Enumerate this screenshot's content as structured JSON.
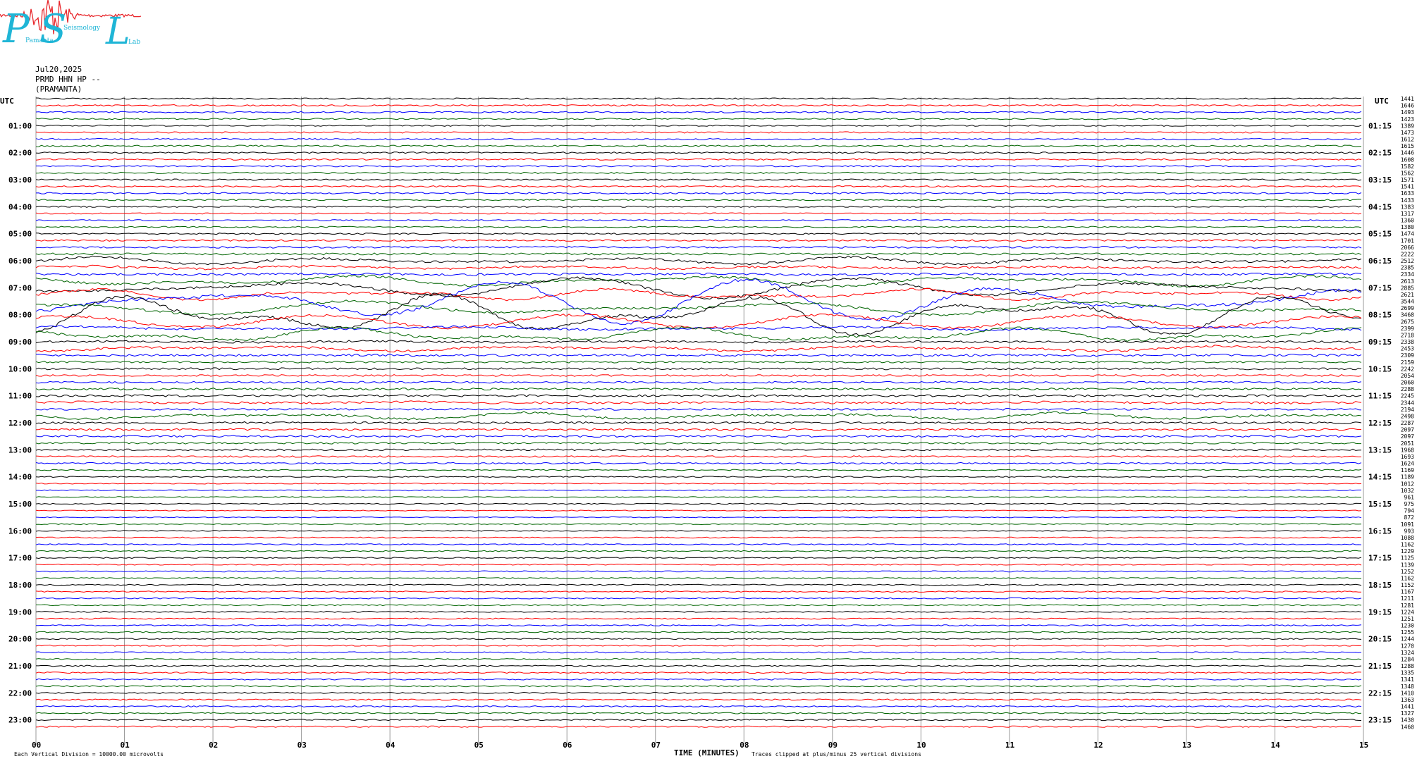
{
  "logo": {
    "letters": [
      "P",
      "S",
      "L"
    ],
    "words": [
      "Pamanta",
      "Seismology",
      "Lab"
    ],
    "color_letters": "#1fb5d6",
    "color_wave": "#e8262b"
  },
  "header": {
    "date": "Jul20,2025",
    "station": "PRMD HHN HP --",
    "location": "(PRAMANTA)"
  },
  "chart_data": {
    "type": "line",
    "title": "",
    "xlabel": "TIME (MINUTES)",
    "ylabel": "",
    "xlim": [
      0,
      15
    ],
    "x_ticks": [
      "00",
      "01",
      "02",
      "03",
      "04",
      "05",
      "06",
      "07",
      "08",
      "09",
      "10",
      "11",
      "12",
      "13",
      "14",
      "15"
    ],
    "left_axis_label": "UTC",
    "right_axis_label": "UTC",
    "left_hour_labels": [
      "01:00",
      "02:00",
      "03:00",
      "04:00",
      "05:00",
      "06:00",
      "07:00",
      "08:00",
      "09:00",
      "10:00",
      "11:00",
      "12:00",
      "13:00",
      "14:00",
      "15:00",
      "16:00",
      "17:00",
      "18:00",
      "19:00",
      "20:00",
      "21:00",
      "22:00",
      "23:00"
    ],
    "right_hour_labels": [
      "01:15",
      "02:15",
      "03:15",
      "04:15",
      "05:15",
      "06:15",
      "07:15",
      "08:15",
      "09:15",
      "10:15",
      "11:15",
      "12:15",
      "13:15",
      "14:15",
      "15:15",
      "16:15",
      "17:15",
      "18:15",
      "19:15",
      "20:15",
      "21:15",
      "22:15",
      "23:15"
    ],
    "trace_colors": [
      "#000000",
      "#ff0000",
      "#0000ff",
      "#006400"
    ],
    "traces_per_hour": 4,
    "trace_count": 96,
    "rms_counts": [
      1441,
      1646,
      1493,
      1423,
      1389,
      1473,
      1612,
      1615,
      1446,
      1608,
      1582,
      1562,
      1571,
      1541,
      1633,
      1433,
      1383,
      1317,
      1360,
      1380,
      1474,
      1701,
      2066,
      2222,
      2512,
      2385,
      2334,
      2613,
      2885,
      2621,
      3544,
      2699,
      3468,
      2675,
      2399,
      2718,
      2338,
      2453,
      2309,
      2159,
      2242,
      2054,
      2060,
      2288,
      2245,
      2344,
      2194,
      2498,
      2287,
      2097,
      2097,
      2051,
      1968,
      1693,
      1624,
      1169,
      1189,
      1012,
      1032,
      961,
      975,
      794,
      872,
      1091,
      993,
      1088,
      1162,
      1229,
      1125,
      1139,
      1252,
      1162,
      1152,
      1167,
      1211,
      1281,
      1224,
      1251,
      1230,
      1255,
      1244,
      1270,
      1324,
      1284,
      1288,
      1335,
      1341,
      1348,
      1410,
      1363,
      1441,
      1327,
      1430,
      1460
    ],
    "trace_scale": "Each Vertical Division = 10000.00 microvolts",
    "clip_note": "Traces clipped at plus/minus 25 vertical divisions"
  }
}
